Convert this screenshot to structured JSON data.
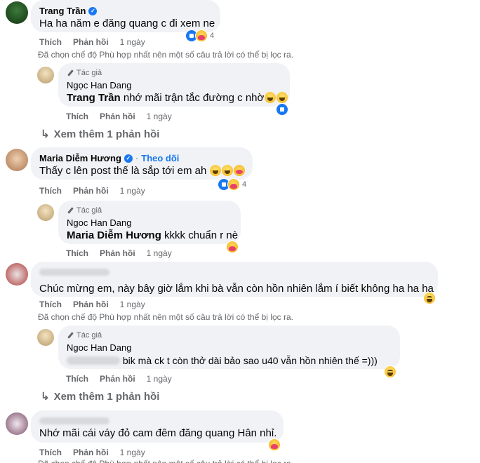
{
  "actions": {
    "like": "Thích",
    "reply": "Phản hồi",
    "time_1day": "1 ngày"
  },
  "filter_note": "Đã chọn chế độ Phù hợp nhất nên một số câu trả lời có thể bị lọc ra.",
  "tag_author": "Tác giả",
  "comments": [
    {
      "author": "Trang Trần",
      "text": "Ha ha năm e đăng quang c đi xem ne",
      "reaction_count": "4",
      "reply": {
        "author": "Ngọc Han Dang",
        "mention": "Trang Trần",
        "text": " nhớ mãi trận tắc đường c nhờ"
      },
      "more": "Xem thêm 1 phản hồi"
    },
    {
      "author": "Maria Diễm Hương",
      "follow": "Theo dõi",
      "text": "Thấy c lên post thế là sắp tới em ah",
      "reaction_count": "4",
      "reply": {
        "author": "Ngoc Han Dang",
        "mention": "Maria Diễm Hương",
        "text": " kkkk chuẩn r nè"
      }
    },
    {
      "text": "Chúc mừng em, này bây giờ lắm khi bà vẫn còn hồn nhiên lắm í biết không ha ha ha",
      "reply": {
        "author": "Ngoc Han Dang",
        "text": " bik mà ck t còn thở dài bảo sao u40 vẫn hồn nhiên thế =)))"
      },
      "more": "Xem thêm 1 phản hồi"
    },
    {
      "text": "Nhớ mãi cái váy đỏ cam đêm đăng quang Hân nhỉ."
    }
  ]
}
